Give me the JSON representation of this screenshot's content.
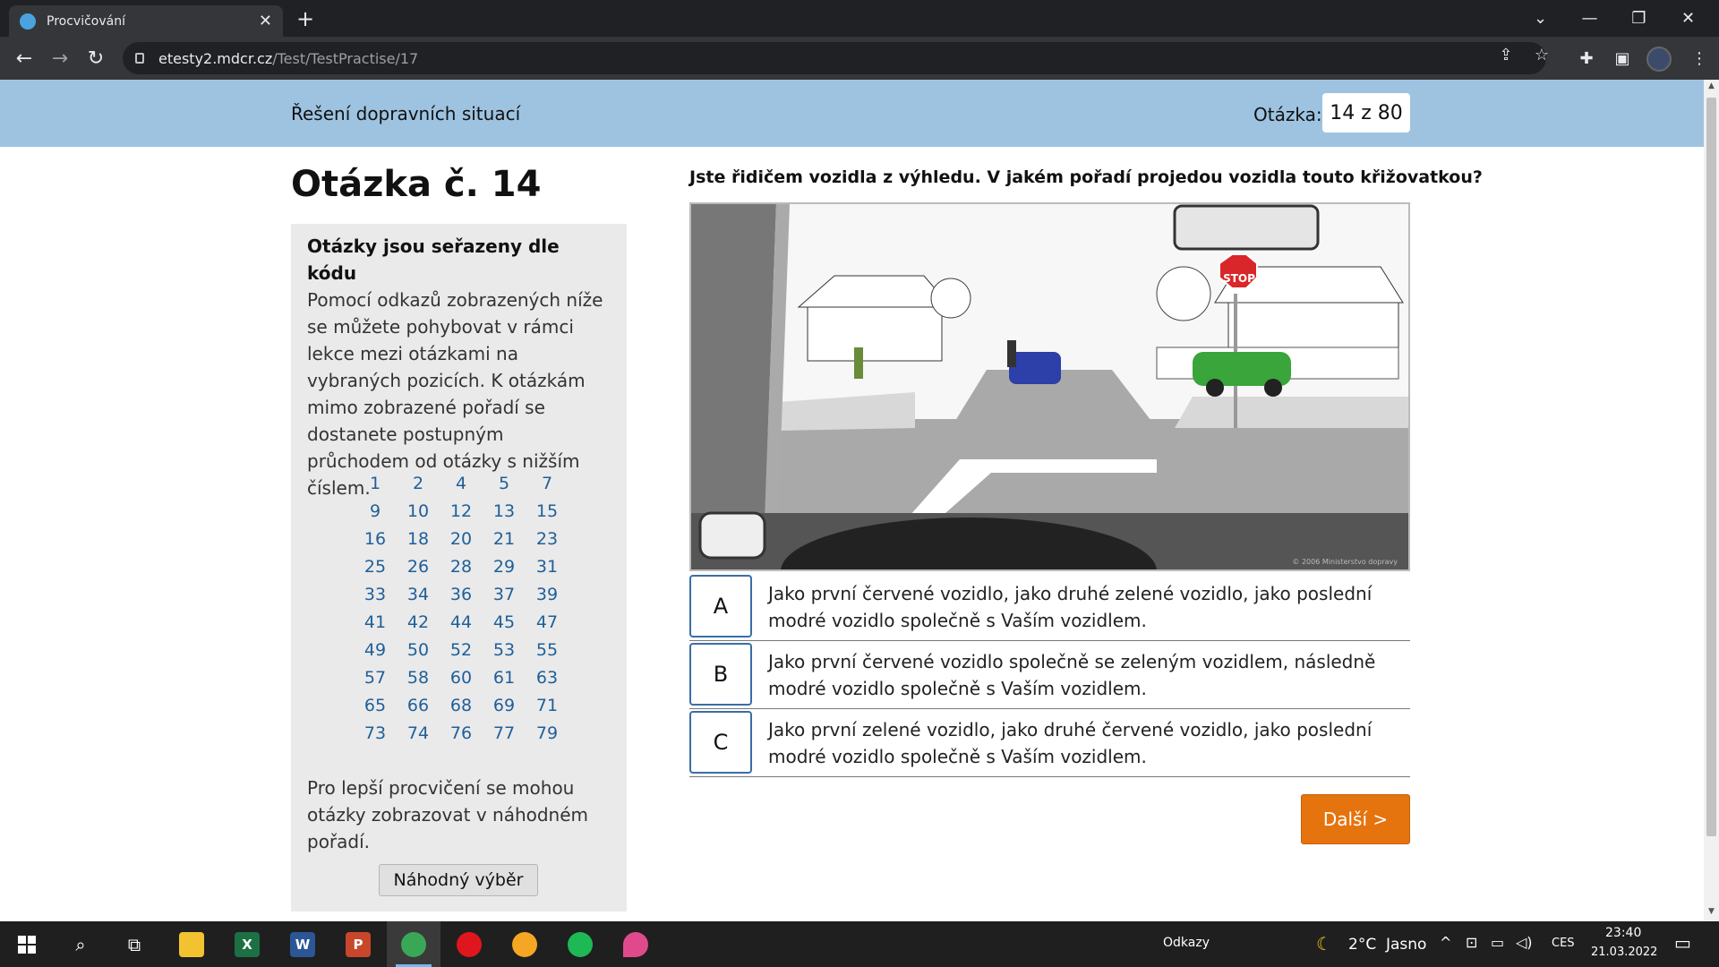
{
  "browser": {
    "tab_title": "Procvičování",
    "url_host": "etesty2.mdcr.cz",
    "url_path": "/Test/TestPractise/17"
  },
  "header": {
    "title": "Řešení dopravních situací",
    "question_label": "Otázka:",
    "question_counter": "14 z 80"
  },
  "main": {
    "heading": "Otázka č. 14",
    "question_text": "Jste řidičem vozidla z výhledu. V jakém pořadí projedou vozidla touto křižovatkou?",
    "scene_sign": "STOP",
    "scene_copyright": "© 2006 Ministerstvo dopravy"
  },
  "sidebar": {
    "title": "Otázky jsou seřazeny dle kódu",
    "text": "Pomocí odkazů zobrazených níže se můžete pohybovat v rámci lekce mezi otázkami na vybraných pozicích. K otázkám mimo zobrazené pořadí se dostanete postupným průchodem od otázky s nižším číslem.",
    "rows": [
      [
        "1",
        "2",
        "4",
        "5",
        "7"
      ],
      [
        "9",
        "10",
        "12",
        "13",
        "15"
      ],
      [
        "16",
        "18",
        "20",
        "21",
        "23"
      ],
      [
        "25",
        "26",
        "28",
        "29",
        "31"
      ],
      [
        "33",
        "34",
        "36",
        "37",
        "39"
      ],
      [
        "41",
        "42",
        "44",
        "45",
        "47"
      ],
      [
        "49",
        "50",
        "52",
        "53",
        "55"
      ],
      [
        "57",
        "58",
        "60",
        "61",
        "63"
      ],
      [
        "65",
        "66",
        "68",
        "69",
        "71"
      ],
      [
        "73",
        "74",
        "76",
        "77",
        "79"
      ]
    ],
    "random_text": "Pro lepší procvičení se mohou otázky zobrazovat v náhodném pořadí.",
    "random_button": "Náhodný výběr"
  },
  "answers": [
    {
      "letter": "A",
      "text": "Jako první červené vozidlo, jako druhé zelené vozidlo, jako poslední modré vozidlo společně s Vaším vozidlem."
    },
    {
      "letter": "B",
      "text": "Jako první červené vozidlo společně se zeleným vozidlem, následně modré vozidlo společně s Vaším vozidlem."
    },
    {
      "letter": "C",
      "text": "Jako první zelené vozidlo, jako druhé červené vozidlo, jako poslední modré vozidlo společně s Vaším vozidlem."
    }
  ],
  "next_button": "Další >",
  "taskbar": {
    "links_label": "Odkazy",
    "weather": "2°C  Jasno",
    "language": "CES",
    "time": "23:40",
    "date": "21.03.2022"
  }
}
